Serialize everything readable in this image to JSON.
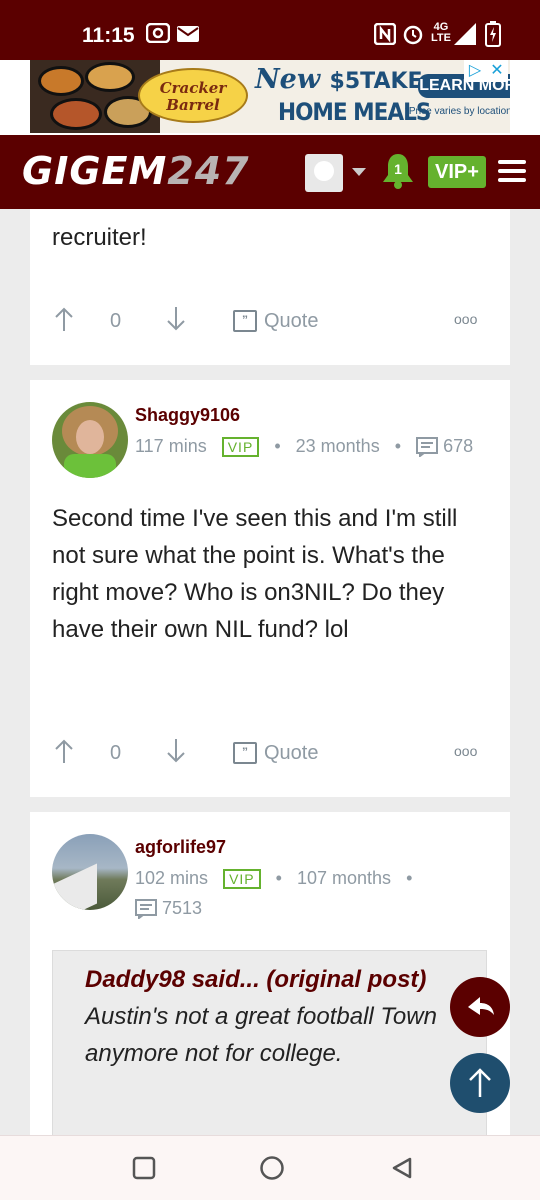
{
  "status_bar": {
    "time": "11:15",
    "network": "4G LTE",
    "icons": [
      "nfc-icon",
      "alarm-icon",
      "signal-icon",
      "battery-icon"
    ]
  },
  "ad": {
    "brand": "Cracker Barrel",
    "headline_script": "New",
    "headline_price": "$5",
    "headline_take": "TAKE",
    "headline_line2": "HOME MEALS",
    "cta": "LEARN MORE",
    "note": "*Price varies by location."
  },
  "navbar": {
    "logo_main": "GIGEM",
    "logo_num": "247",
    "notification_count": "1",
    "vip_label": "VIP+"
  },
  "posts": [
    {
      "text_tail": "recruiter!",
      "votes": "0",
      "quote_label": "Quote"
    },
    {
      "username": "Shaggy9106",
      "time": "117 mins",
      "vip": "VIP",
      "member_age": "23 months",
      "post_count": "678",
      "text": "Second time I've seen this and I'm still not sure what the point is. What's the right move? Who is on3NIL? Do they have their own NIL fund? lol",
      "votes": "0",
      "quote_label": "Quote"
    },
    {
      "username": "agforlife97",
      "time": "102 mins",
      "vip": "VIP",
      "member_age": "107 months",
      "post_count": "7513",
      "quote": {
        "author": "Daddy98 said...",
        "original_link": "(original post)",
        "text": "Austin's not a great football Town anymore not for college."
      }
    }
  ],
  "colors": {
    "brand_maroon": "#5b0000",
    "vip_green": "#65b22e",
    "muted_text": "#8f9aa3"
  }
}
